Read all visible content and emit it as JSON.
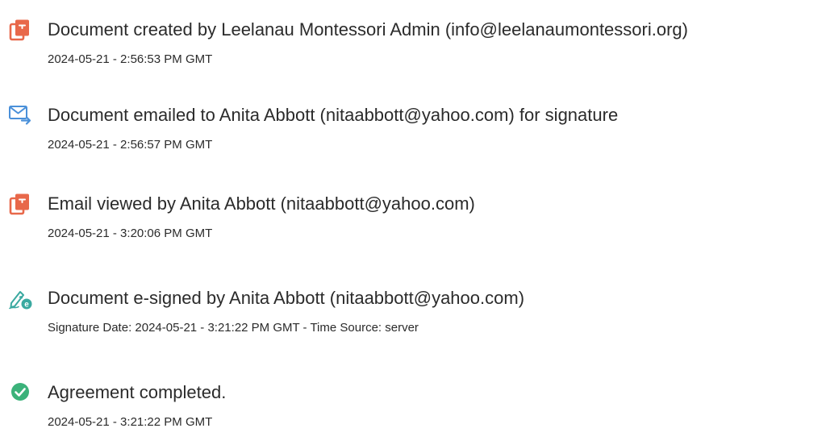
{
  "events": [
    {
      "icon": "document-created-icon",
      "title": "Document created by Leelanau Montessori Admin (info@leelanaumontessori.org)",
      "subtitle": "2024-05-21 - 2:56:53 PM GMT"
    },
    {
      "icon": "email-sent-icon",
      "title": "Document emailed to Anita Abbott (nitaabbott@yahoo.com) for signature",
      "subtitle": "2024-05-21 - 2:56:57 PM GMT"
    },
    {
      "icon": "email-viewed-icon",
      "title": "Email viewed by Anita Abbott (nitaabbott@yahoo.com)",
      "subtitle": "2024-05-21 - 3:20:06 PM GMT"
    },
    {
      "icon": "e-signed-icon",
      "title": "Document e-signed by Anita Abbott (nitaabbott@yahoo.com)",
      "subtitle": "Signature Date: 2024-05-21 - 3:21:22 PM GMT - Time Source: server"
    },
    {
      "icon": "completed-check-icon",
      "title": "Agreement completed.",
      "subtitle": "2024-05-21 - 3:21:22 PM GMT"
    }
  ],
  "colors": {
    "doc_icon": "#e8684a",
    "email_icon": "#4a90d9",
    "sign_icon": "#3aa9a0",
    "check_icon": "#3bb27a",
    "text": "#2b2b2b"
  }
}
